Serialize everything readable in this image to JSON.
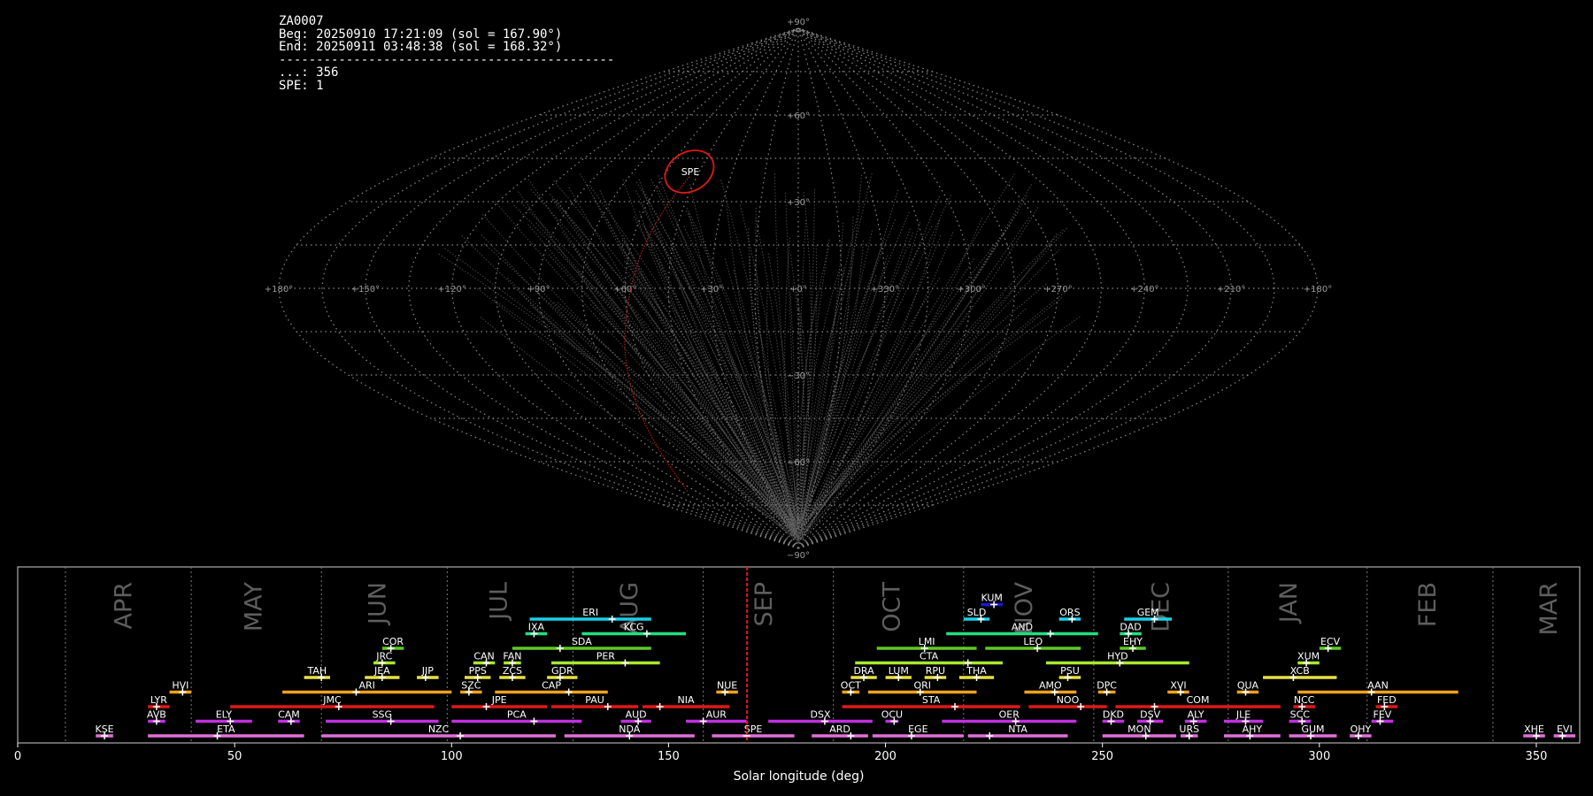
{
  "info": {
    "lines": [
      "ZA0007",
      "Beg: 20250910 17:21:09 (sol = 167.90°)",
      "End: 20250911 03:48:38 (sol = 168.32°)",
      "---------------------------------------------",
      "...: 356",
      "SPE: 1"
    ]
  },
  "chart_data": [
    {
      "type": "scatter",
      "title": "",
      "projection": "sinusoidal",
      "lon_tick_labels": [
        "+180°",
        "+150°",
        "+120°",
        "+90°",
        "+60°",
        "+30°",
        "+0°",
        "+330°",
        "+300°",
        "+270°",
        "+240°",
        "+210°",
        "+180°"
      ],
      "lat_tick_labels": [
        "+90°",
        "+60°",
        "+30°",
        "−30°",
        "−60°",
        "−90°"
      ],
      "grid": true,
      "annotations": [
        {
          "label": "SPE",
          "shape": "ellipse",
          "color": "#e01818"
        }
      ],
      "series": [
        {
          "color": "#e01818",
          "x": [
            -47,
            -85,
            -97,
            -126
          ],
          "y": [
            7,
            -12,
            30,
            -59
          ]
        }
      ]
    },
    {
      "type": "bar",
      "xlabel": "Solar longitude (deg)",
      "xlim": [
        0,
        360
      ],
      "x_ticks": [
        0,
        50,
        100,
        150,
        200,
        250,
        300,
        350
      ],
      "current_sol": 168.1,
      "months": [
        {
          "label": "APR",
          "start": 11.0,
          "center": 24.5
        },
        {
          "label": "MAY",
          "start": 40.0,
          "center": 54.5
        },
        {
          "label": "JUN",
          "start": 70.0,
          "center": 83.0
        },
        {
          "label": "JUL",
          "start": 99.0,
          "center": 111.0
        },
        {
          "label": "AUG",
          "start": 128.0,
          "center": 141.0
        },
        {
          "label": "SEP",
          "start": 158.0,
          "center": 172.0
        },
        {
          "label": "OCT",
          "start": 188.0,
          "center": 201.5
        },
        {
          "label": "NOV",
          "start": 218.0,
          "center": 232.0
        },
        {
          "label": "DEC",
          "start": 248.0,
          "center": 263.5
        },
        {
          "label": "JAN",
          "start": 279.0,
          "center": 293.0
        },
        {
          "label": "FEB",
          "start": 311.0,
          "center": 325.0
        },
        {
          "label": "MAR",
          "start": 340.0,
          "center": 353.0
        }
      ],
      "showers": [
        {
          "code": "KUM",
          "row": 9,
          "start": 222,
          "end": 227,
          "peak": 225,
          "color": "#1a1ad8"
        },
        {
          "code": "ERI",
          "row": 8,
          "start": 118,
          "end": 146,
          "peak": 137,
          "color": "#18d0e8"
        },
        {
          "code": "SLD",
          "row": 8,
          "start": 218,
          "end": 224,
          "peak": 222,
          "color": "#18d0e8"
        },
        {
          "code": "ORS",
          "row": 8,
          "start": 240,
          "end": 245,
          "peak": 243,
          "color": "#18d0e8"
        },
        {
          "code": "GEM",
          "row": 8,
          "start": 255,
          "end": 266,
          "peak": 262,
          "color": "#18d0e8"
        },
        {
          "code": "IXA",
          "row": 7,
          "start": 117,
          "end": 122,
          "peak": 119,
          "color": "#20e080"
        },
        {
          "code": "KCG",
          "row": 7,
          "start": 130,
          "end": 154,
          "peak": 145,
          "color": "#20e080"
        },
        {
          "code": "AND",
          "row": 7,
          "start": 214,
          "end": 249,
          "peak": 238,
          "color": "#20e080"
        },
        {
          "code": "DAD",
          "row": 7,
          "start": 254,
          "end": 259,
          "peak": 256,
          "color": "#20e080"
        },
        {
          "code": "COR",
          "row": 6,
          "start": 84,
          "end": 89,
          "peak": 86,
          "color": "#60c828"
        },
        {
          "code": "SDA",
          "row": 6,
          "start": 114,
          "end": 146,
          "peak": 125,
          "color": "#60c828"
        },
        {
          "code": "LMI",
          "row": 6,
          "start": 198,
          "end": 221,
          "peak": 209,
          "color": "#60c828"
        },
        {
          "code": "LEO",
          "row": 6,
          "start": 223,
          "end": 245,
          "peak": 235,
          "color": "#60c828"
        },
        {
          "code": "EHY",
          "row": 6,
          "start": 254,
          "end": 260,
          "peak": 257,
          "color": "#60c828"
        },
        {
          "code": "ECV",
          "row": 6,
          "start": 300,
          "end": 305,
          "peak": 302,
          "color": "#60c828"
        },
        {
          "code": "JRC",
          "row": 5,
          "start": 82,
          "end": 87,
          "peak": 84,
          "color": "#a8e830"
        },
        {
          "code": "CAN",
          "row": 5,
          "start": 105,
          "end": 110,
          "peak": 108,
          "color": "#a8e830"
        },
        {
          "code": "FAN",
          "row": 5,
          "start": 112,
          "end": 116,
          "peak": 114,
          "color": "#a8e830"
        },
        {
          "code": "PER",
          "row": 5,
          "start": 123,
          "end": 148,
          "peak": 140,
          "color": "#a8e830"
        },
        {
          "code": "CTA",
          "row": 5,
          "start": 193,
          "end": 227,
          "peak": 219,
          "color": "#a8e830"
        },
        {
          "code": "HYD",
          "row": 5,
          "start": 237,
          "end": 270,
          "peak": 254,
          "color": "#a8e830"
        },
        {
          "code": "XUM",
          "row": 5,
          "start": 295,
          "end": 300,
          "peak": 297,
          "color": "#a8e830"
        },
        {
          "code": "TAH",
          "row": 4,
          "start": 66,
          "end": 72,
          "peak": 70,
          "color": "#e8e040"
        },
        {
          "code": "JEA",
          "row": 4,
          "start": 80,
          "end": 88,
          "peak": 84,
          "color": "#e8e040"
        },
        {
          "code": "JIP",
          "row": 4,
          "start": 92,
          "end": 97,
          "peak": 94,
          "color": "#e8e040"
        },
        {
          "code": "PPS",
          "row": 4,
          "start": 103,
          "end": 109,
          "peak": 106,
          "color": "#e8e040"
        },
        {
          "code": "ZCS",
          "row": 4,
          "start": 111,
          "end": 117,
          "peak": 114,
          "color": "#e8e040"
        },
        {
          "code": "GDR",
          "row": 4,
          "start": 122,
          "end": 129,
          "peak": 125,
          "color": "#e8e040"
        },
        {
          "code": "DRA",
          "row": 4,
          "start": 192,
          "end": 198,
          "peak": 195,
          "color": "#e8e040"
        },
        {
          "code": "LUM",
          "row": 4,
          "start": 200,
          "end": 206,
          "peak": 203,
          "color": "#e8e040"
        },
        {
          "code": "RPU",
          "row": 4,
          "start": 209,
          "end": 214,
          "peak": 212,
          "color": "#e8e040"
        },
        {
          "code": "THA",
          "row": 4,
          "start": 217,
          "end": 225,
          "peak": 221,
          "color": "#e8e040"
        },
        {
          "code": "PSU",
          "row": 4,
          "start": 240,
          "end": 245,
          "peak": 242,
          "color": "#e8e040"
        },
        {
          "code": "XCB",
          "row": 4,
          "start": 287,
          "end": 304,
          "peak": 294,
          "color": "#e8e040"
        },
        {
          "code": "HVI",
          "row": 3,
          "start": 35,
          "end": 40,
          "peak": 38,
          "color": "#f0a020"
        },
        {
          "code": "ARI",
          "row": 3,
          "start": 61,
          "end": 100,
          "peak": 78,
          "color": "#f0a020"
        },
        {
          "code": "SZC",
          "row": 3,
          "start": 102,
          "end": 107,
          "peak": 104,
          "color": "#f0a020"
        },
        {
          "code": "CAP",
          "row": 3,
          "start": 110,
          "end": 136,
          "peak": 127,
          "color": "#f0a020"
        },
        {
          "code": "NUE",
          "row": 3,
          "start": 161,
          "end": 166,
          "peak": 163,
          "color": "#f0a020"
        },
        {
          "code": "OCT",
          "row": 3,
          "start": 190,
          "end": 194,
          "peak": 192,
          "color": "#f0a020"
        },
        {
          "code": "ORI",
          "row": 3,
          "start": 196,
          "end": 221,
          "peak": 208,
          "color": "#f0a020"
        },
        {
          "code": "AMO",
          "row": 3,
          "start": 232,
          "end": 244,
          "peak": 239,
          "color": "#f0a020"
        },
        {
          "code": "DPC",
          "row": 3,
          "start": 249,
          "end": 253,
          "peak": 251,
          "color": "#f0a020"
        },
        {
          "code": "XVI",
          "row": 3,
          "start": 265,
          "end": 270,
          "peak": 268,
          "color": "#f0a020"
        },
        {
          "code": "QUA",
          "row": 3,
          "start": 281,
          "end": 286,
          "peak": 283,
          "color": "#f0a020"
        },
        {
          "code": "AAN",
          "row": 3,
          "start": 295,
          "end": 332,
          "peak": 312,
          "color": "#f0a020"
        },
        {
          "code": "LYR",
          "row": 2,
          "start": 30,
          "end": 35,
          "peak": 32,
          "color": "#e01818"
        },
        {
          "code": "JMC",
          "row": 2,
          "start": 49,
          "end": 96,
          "peak": 74,
          "color": "#e01818"
        },
        {
          "code": "JPE",
          "row": 2,
          "start": 100,
          "end": 122,
          "peak": 108,
          "color": "#e01818"
        },
        {
          "code": "PAU",
          "row": 2,
          "start": 123,
          "end": 143,
          "peak": 136,
          "color": "#e01818"
        },
        {
          "code": "NIA",
          "row": 2,
          "start": 144,
          "end": 164,
          "peak": 148,
          "color": "#e01818"
        },
        {
          "code": "STA",
          "row": 2,
          "start": 190,
          "end": 231,
          "peak": 216,
          "color": "#e01818"
        },
        {
          "code": "NOO",
          "row": 2,
          "start": 233,
          "end": 251,
          "peak": 245,
          "color": "#e01818"
        },
        {
          "code": "COM",
          "row": 2,
          "start": 253,
          "end": 291,
          "peak": 262,
          "color": "#e01818"
        },
        {
          "code": "NCC",
          "row": 2,
          "start": 294,
          "end": 299,
          "peak": 296,
          "color": "#e01818"
        },
        {
          "code": "FED",
          "row": 2,
          "start": 313,
          "end": 318,
          "peak": 315,
          "color": "#e01818"
        },
        {
          "code": "AVB",
          "row": 1,
          "start": 30,
          "end": 34,
          "peak": 32,
          "color": "#c030e0"
        },
        {
          "code": "ELY",
          "row": 1,
          "start": 41,
          "end": 54,
          "peak": 49,
          "color": "#c030e0"
        },
        {
          "code": "CAM",
          "row": 1,
          "start": 60,
          "end": 65,
          "peak": 63,
          "color": "#c030e0"
        },
        {
          "code": "SSG",
          "row": 1,
          "start": 71,
          "end": 97,
          "peak": 86,
          "color": "#c030e0"
        },
        {
          "code": "PCA",
          "row": 1,
          "start": 100,
          "end": 130,
          "peak": 119,
          "color": "#c030e0"
        },
        {
          "code": "AUD",
          "row": 1,
          "start": 139,
          "end": 146,
          "peak": 143,
          "color": "#c030e0"
        },
        {
          "code": "AUR",
          "row": 1,
          "start": 154,
          "end": 168,
          "peak": 158,
          "color": "#c030e0"
        },
        {
          "code": "DSX",
          "row": 1,
          "start": 173,
          "end": 197,
          "peak": 186,
          "color": "#c030e0"
        },
        {
          "code": "OCU",
          "row": 1,
          "start": 200,
          "end": 203,
          "peak": 202,
          "color": "#c030e0"
        },
        {
          "code": "OER",
          "row": 1,
          "start": 213,
          "end": 244,
          "peak": 230,
          "color": "#c030e0"
        },
        {
          "code": "DKD",
          "row": 1,
          "start": 250,
          "end": 255,
          "peak": 252,
          "color": "#c030e0"
        },
        {
          "code": "DSV",
          "row": 1,
          "start": 258,
          "end": 264,
          "peak": 261,
          "color": "#c030e0"
        },
        {
          "code": "ALY",
          "row": 1,
          "start": 269,
          "end": 274,
          "peak": 271,
          "color": "#c030e0"
        },
        {
          "code": "JLE",
          "row": 1,
          "start": 278,
          "end": 287,
          "peak": 283,
          "color": "#c030e0"
        },
        {
          "code": "SCC",
          "row": 1,
          "start": 293,
          "end": 298,
          "peak": 296,
          "color": "#c030e0"
        },
        {
          "code": "FEV",
          "row": 1,
          "start": 312,
          "end": 317,
          "peak": 314,
          "color": "#c030e0"
        },
        {
          "code": "KSE",
          "row": 0,
          "start": 18,
          "end": 22,
          "peak": 20,
          "color": "#e070d8"
        },
        {
          "code": "ETA",
          "row": 0,
          "start": 30,
          "end": 66,
          "peak": 46,
          "color": "#e070d8"
        },
        {
          "code": "NZC",
          "row": 0,
          "start": 70,
          "end": 124,
          "peak": 102,
          "color": "#e070d8"
        },
        {
          "code": "NDA",
          "row": 0,
          "start": 126,
          "end": 156,
          "peak": 141,
          "color": "#e070d8"
        },
        {
          "code": "SPE",
          "row": 0,
          "start": 160,
          "end": 179,
          "peak": 168,
          "color": "#e070d8"
        },
        {
          "code": "ARD",
          "row": 0,
          "start": 183,
          "end": 196,
          "peak": 192,
          "color": "#e070d8"
        },
        {
          "code": "EGE",
          "row": 0,
          "start": 197,
          "end": 218,
          "peak": 206,
          "color": "#e070d8"
        },
        {
          "code": "NTA",
          "row": 0,
          "start": 219,
          "end": 242,
          "peak": 224,
          "color": "#e070d8"
        },
        {
          "code": "MON",
          "row": 0,
          "start": 250,
          "end": 267,
          "peak": 260,
          "color": "#e070d8"
        },
        {
          "code": "URS",
          "row": 0,
          "start": 268,
          "end": 272,
          "peak": 270,
          "color": "#e070d8"
        },
        {
          "code": "AHY",
          "row": 0,
          "start": 278,
          "end": 291,
          "peak": 284,
          "color": "#e070d8"
        },
        {
          "code": "GUM",
          "row": 0,
          "start": 293,
          "end": 304,
          "peak": 298,
          "color": "#e070d8"
        },
        {
          "code": "OHY",
          "row": 0,
          "start": 307,
          "end": 312,
          "peak": 309,
          "color": "#e070d8"
        },
        {
          "code": "XHE",
          "row": 0,
          "start": 347,
          "end": 352,
          "peak": 350,
          "color": "#e070d8"
        },
        {
          "code": "EVI",
          "row": 0,
          "start": 354,
          "end": 359,
          "peak": 356,
          "color": "#e070d8"
        }
      ]
    }
  ]
}
